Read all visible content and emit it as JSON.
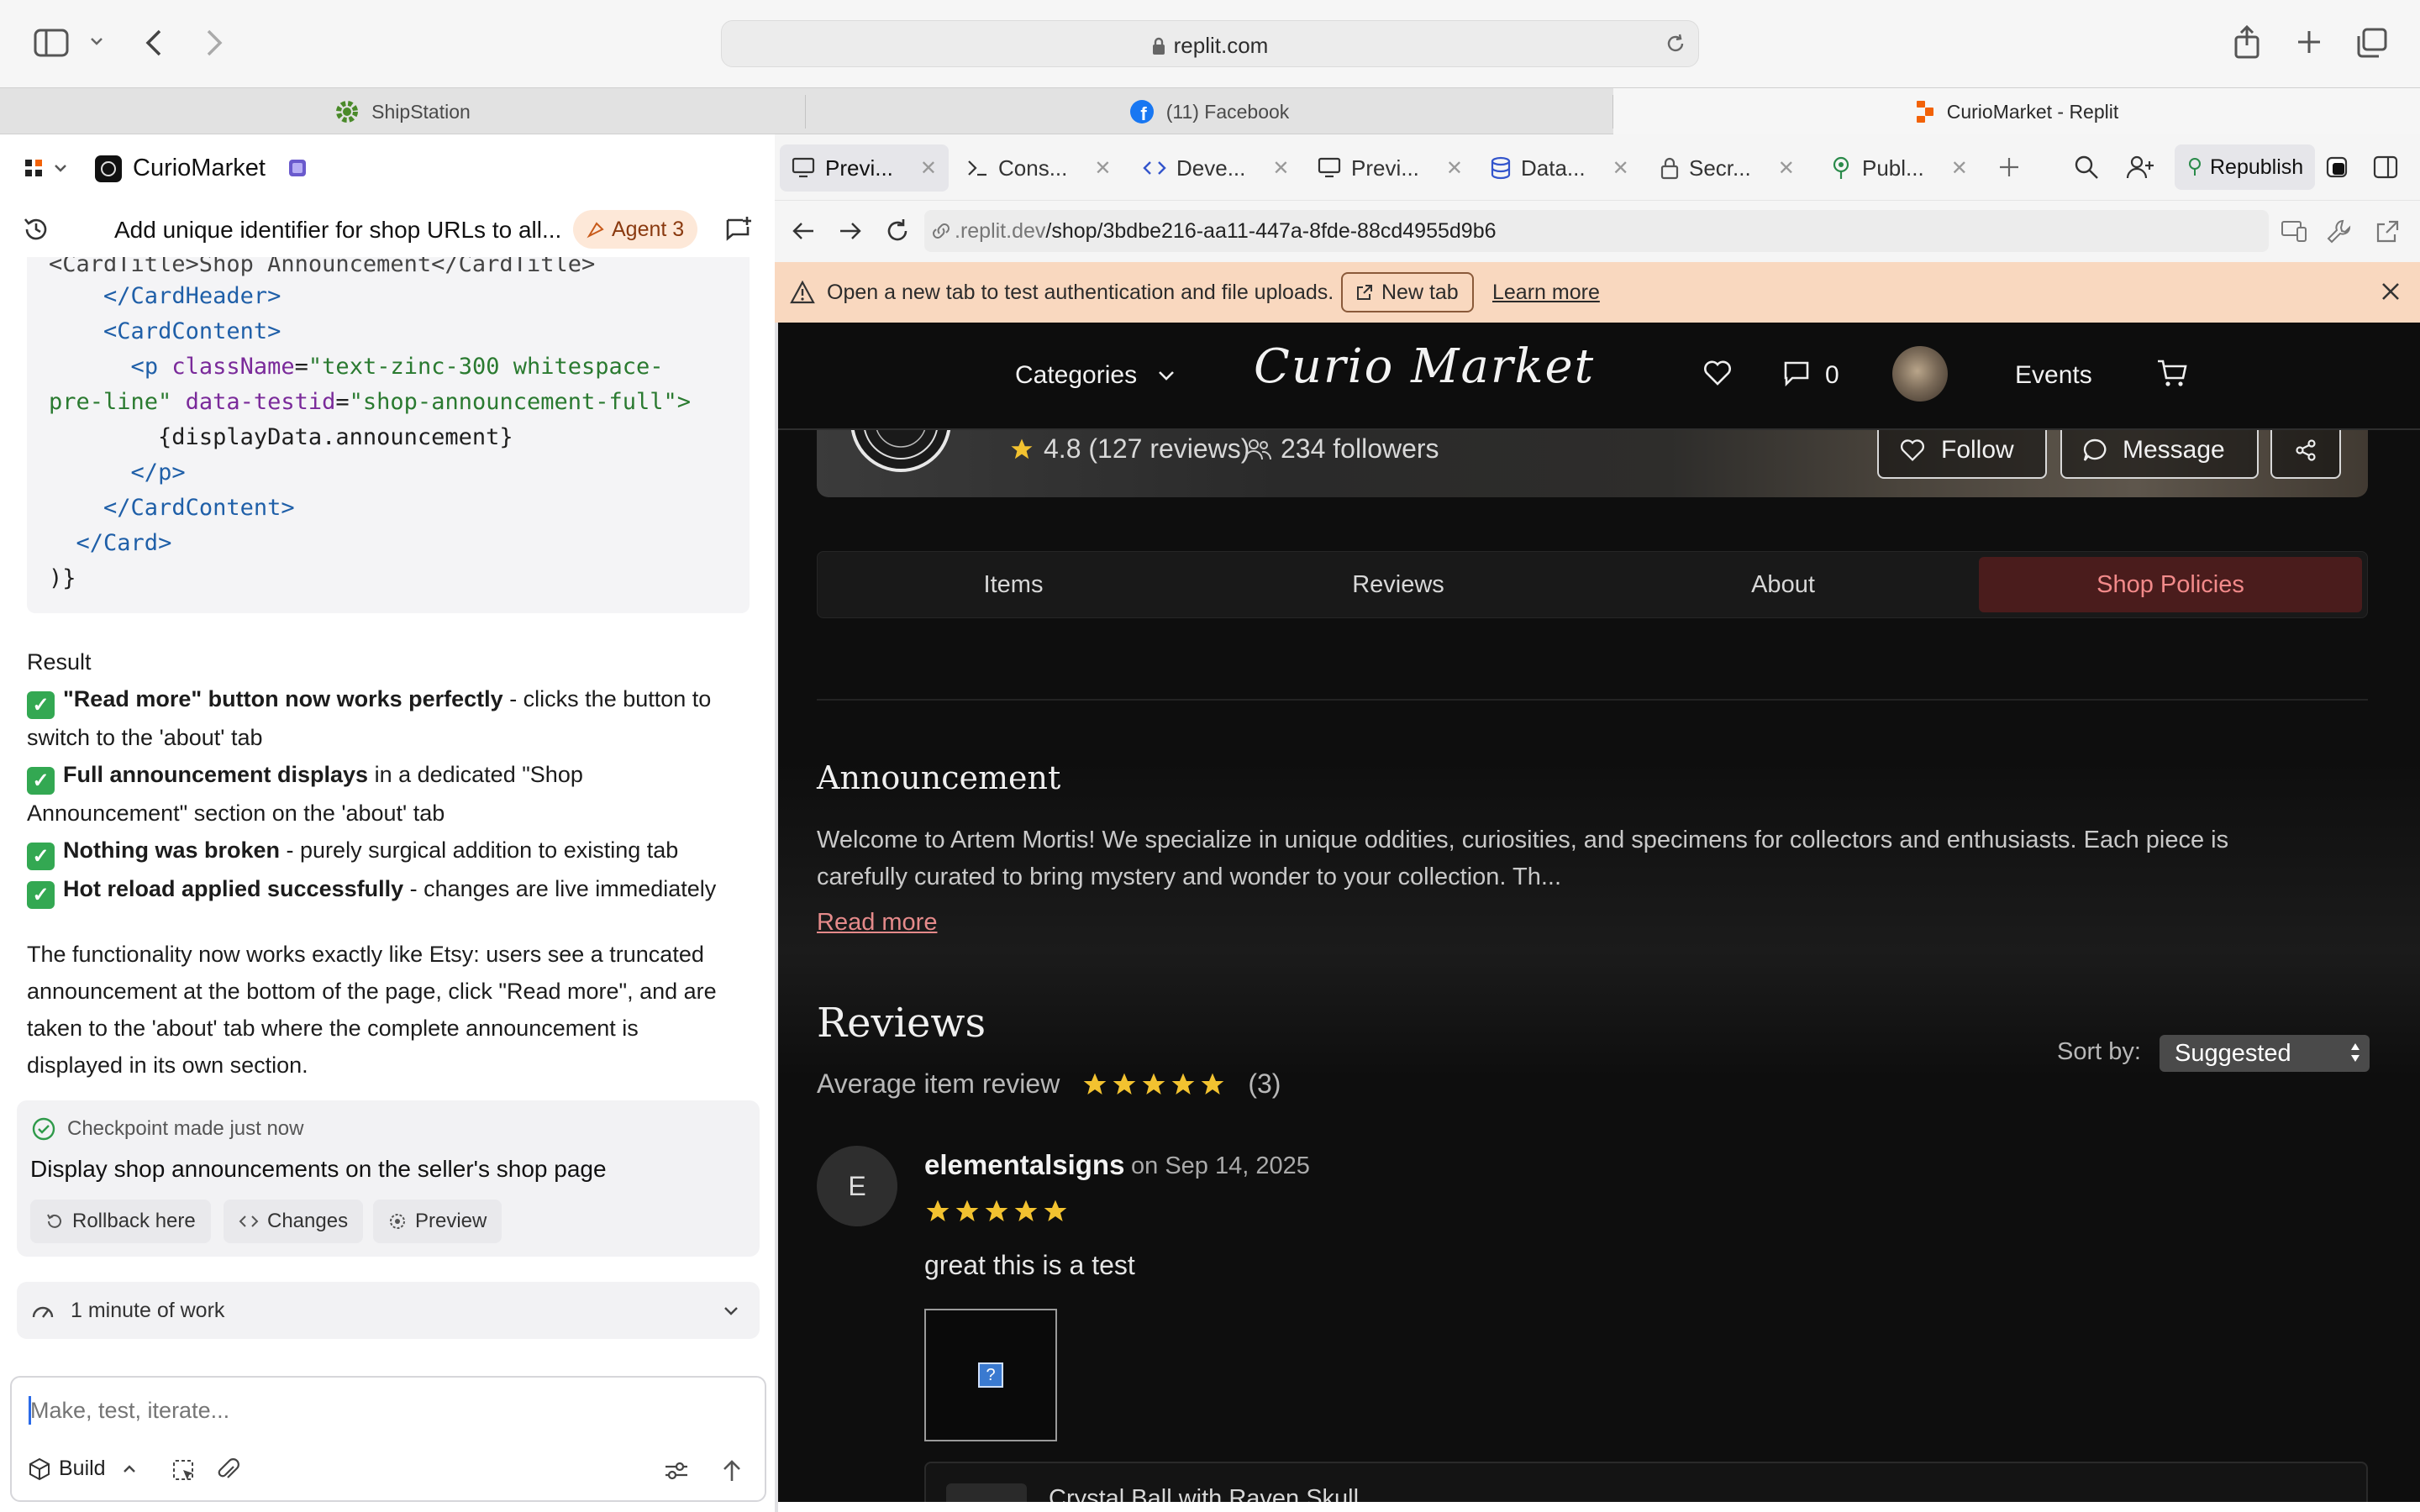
{
  "browser": {
    "url": "replit.com",
    "tabs": [
      {
        "label": "ShipStation"
      },
      {
        "label": "(11) Facebook"
      },
      {
        "label": "CurioMarket - Replit"
      }
    ]
  },
  "project": {
    "name": "CurioMarket",
    "task_title": "Add unique identifier for shop URLs to all...",
    "agent_badge": "Agent 3"
  },
  "code_lines": [
    {
      "indent": "    ",
      "open": "</",
      "tag": "CardHeader",
      "close": ">"
    },
    {
      "indent": "    ",
      "open": "<",
      "tag": "CardContent",
      "close": ">"
    },
    {
      "indent": "      ",
      "open": "<",
      "tag": "p",
      "close": ""
    },
    {
      "indent": "        ",
      "text": "{displayData.announcement}"
    },
    {
      "indent": "      ",
      "open": "</",
      "tag": "p",
      "close": ">"
    },
    {
      "indent": "    ",
      "open": "</",
      "tag": "CardContent",
      "close": ">"
    },
    {
      "indent": "  ",
      "open": "</",
      "tag": "Card",
      "close": ">"
    },
    {
      "indent": "",
      "text": ")}"
    }
  ],
  "code_partial": {
    "top": "<CardTitle>Shop Announcement</CardTitle>",
    "p_attr1": "className",
    "p_val1": "\"text-zinc-300 whitespace-",
    "p_val1b": "pre-line\"",
    "p_attr2": "data-testid",
    "p_val2": "\"shop-announcement-full\">"
  },
  "result": {
    "heading": "Result",
    "items": [
      {
        "bold": "\"Read more\" button now works perfectly",
        "rest": " - clicks the button to"
      },
      {
        "bold": "Full announcement displays",
        "rest": " in a dedicated \"Shop"
      },
      {
        "bold": "Nothing was broken",
        "rest": " - purely surgical addition to existing tab"
      },
      {
        "bold": "Hot reload applied successfully",
        "rest": " - changes are live immediately"
      }
    ],
    "wrap1": "switch to the 'about' tab",
    "wrap2": "Announcement\" section on the 'about' tab",
    "summary": [
      "The functionality now works exactly like Etsy: users see a truncated",
      "announcement at the bottom of the page, click \"Read more\", and are",
      "taken to the 'about' tab where the complete announcement is",
      "displayed in its own section."
    ]
  },
  "checkpoint": {
    "status": "Checkpoint made just now",
    "title": "Display shop announcements on the seller's shop page",
    "rollback": "Rollback here",
    "changes": "Changes",
    "preview": "Preview"
  },
  "work": {
    "label": "1 minute of work"
  },
  "composer": {
    "placeholder": "Make, test, iterate...",
    "mode": "Build"
  },
  "workspace_tabs": [
    {
      "label": "Previ..."
    },
    {
      "label": "Cons..."
    },
    {
      "label": "Deve..."
    },
    {
      "label": "Previ..."
    },
    {
      "label": "Data..."
    },
    {
      "label": "Secr..."
    },
    {
      "label": "Publ..."
    }
  ],
  "republish": "Republish",
  "preview_url": {
    "host": ".replit.dev",
    "path": "/shop/3bdbe216-aa11-447a-8fde-88cd4955d9b6"
  },
  "warning": {
    "text": "Open a new tab to test authentication and file uploads.",
    "new_tab": "New tab",
    "learn_more": "Learn more"
  },
  "site": {
    "categories": "Categories",
    "logo": "Curio Market",
    "message_count": "0",
    "events": "Events"
  },
  "shop": {
    "rating": "4.8 (127 reviews)",
    "followers": "234 followers",
    "follow": "Follow",
    "message": "Message"
  },
  "shop_tabs": [
    {
      "label": "Items"
    },
    {
      "label": "Reviews"
    },
    {
      "label": "About"
    },
    {
      "label": "Shop Policies"
    }
  ],
  "announcement": {
    "heading": "Announcement",
    "line1": "Welcome to Artem Mortis! We specialize in unique oddities, curiosities, and specimens for collectors and enthusiasts. Each piece is",
    "line2": "carefully curated to bring mystery and wonder to your collection. Th...",
    "read_more": "Read more"
  },
  "reviews": {
    "heading": "Reviews",
    "average_label": "Average item review",
    "average_rating": 5,
    "count": "(3)",
    "sort_label": "Sort by:",
    "sort_value": "Suggested",
    "items": [
      {
        "initial": "E",
        "user": "elementalsigns",
        "date": "on Sep 14, 2025",
        "rating": 5,
        "text": "great this is a test",
        "item": "Crystal Ball with Raven Skull"
      }
    ]
  },
  "colors": {
    "accent_active_tab": "#f28a8a",
    "warning_bg": "#f9d8bf",
    "star": "#f2c230",
    "success_check": "#33a852"
  }
}
